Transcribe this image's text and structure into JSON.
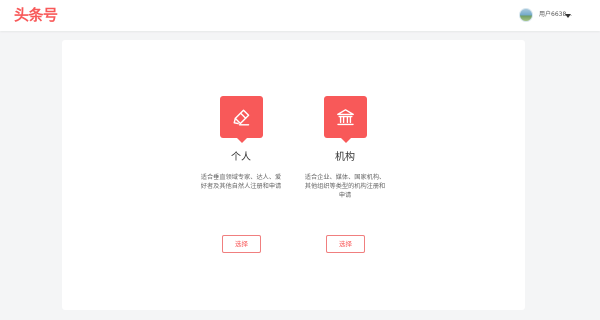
{
  "header": {
    "logo": "头条号",
    "username": "用户6638..."
  },
  "options": [
    {
      "title": "个人",
      "description": "适合垂直领域专家、达人、爱好者及其他自然人注册和申请",
      "button_label": "选择",
      "icon": "pencil-eraser-icon"
    },
    {
      "title": "机构",
      "description": "适合企业、媒体、国家机构、其他组织等类型的机构注册和申请",
      "button_label": "选择",
      "icon": "institution-building-icon"
    }
  ],
  "colors": {
    "accent": "#f85959",
    "accent_border": "#f07f7f",
    "page_bg": "#f4f5f6",
    "card_bg": "#ffffff",
    "caret": "#333333"
  }
}
